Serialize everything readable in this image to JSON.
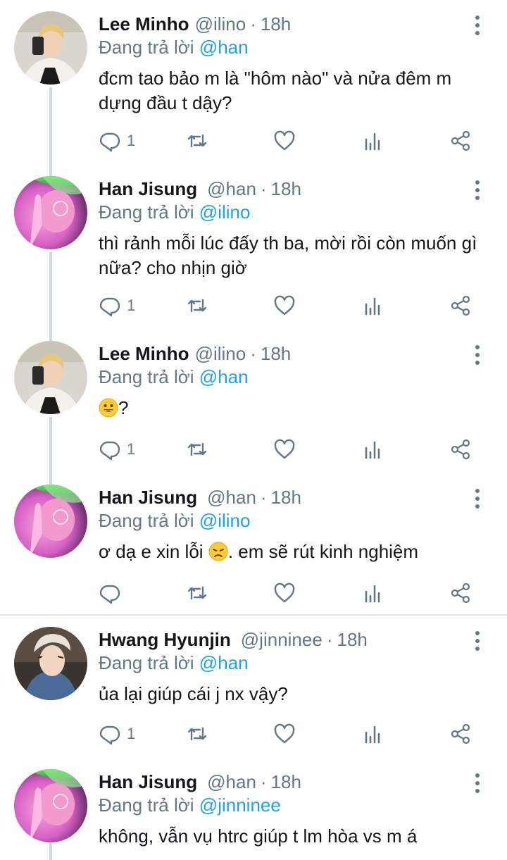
{
  "tweets": [
    {
      "name": "Lee Minho",
      "handle": "@ilino",
      "separator": "·",
      "time": "18h",
      "reply_prefix": "Đang trả lời",
      "reply_to": "@han",
      "text": "đcm tao bảo m là \"hôm nào\" và nửa đêm m dựng đầu t dậy?",
      "reply_count": "1"
    },
    {
      "name": "Han Jisung",
      "handle": "@han",
      "separator": "·",
      "time": "18h",
      "reply_prefix": "Đang trả lời",
      "reply_to": "@ilino",
      "text": "thì rảnh mỗi lúc đấy th ba, mời rồi còn muốn gì nữa? cho nhịn giờ",
      "reply_count": "1"
    },
    {
      "name": "Lee Minho",
      "handle": "@ilino",
      "separator": "·",
      "time": "18h",
      "reply_prefix": "Đang trả lời",
      "reply_to": "@han",
      "text": "?",
      "emoji": "grinning-face",
      "reply_count": "1"
    },
    {
      "name": "Han Jisung",
      "handle": "@han",
      "separator": "·",
      "time": "18h",
      "reply_prefix": "Đang trả lời",
      "reply_to": "@ilino",
      "text_before": "ơ dạ e xin lỗi",
      "text_after": ". em sẽ rút kinh nghiệm",
      "emoji": "disappointed-face",
      "reply_count": ""
    },
    {
      "name": "Hwang Hyunjin",
      "handle": "@jinninee",
      "separator": "·",
      "time": "18h",
      "reply_prefix": "Đang trả lời",
      "reply_to": "@han",
      "text": "ủa lại giúp cái j nx vậy?",
      "reply_count": "1"
    },
    {
      "name": "Han Jisung",
      "handle": "@han",
      "separator": "·",
      "time": "18h",
      "reply_prefix": "Đang trả lời",
      "reply_to": "@jinninee",
      "text": "không, vẫn vụ htrc giúp t lm hòa vs m á"
    }
  ],
  "icons": {
    "reply": "reply-icon",
    "retweet": "retweet-icon",
    "like": "heart-icon",
    "analytics": "analytics-icon",
    "share": "share-icon",
    "more": "more-vertical-icon"
  },
  "colors": {
    "link": "#1da1f2",
    "secondary_text": "#657786",
    "thread_line": "#cfd9de",
    "divider": "#e1e8ed"
  }
}
